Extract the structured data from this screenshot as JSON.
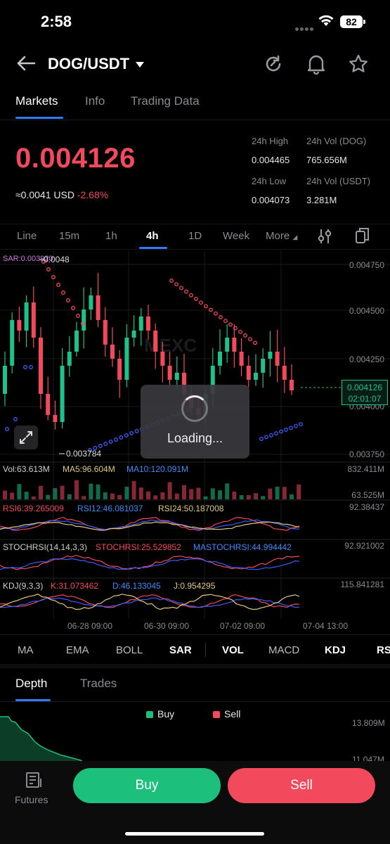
{
  "status": {
    "time": "2:58",
    "battery": "82"
  },
  "header": {
    "pair": "DOG/USDT"
  },
  "tabs": [
    "Markets",
    "Info",
    "Trading Data"
  ],
  "ticker": {
    "price": "0.004126",
    "approx": "≈0.0041 USD",
    "change": "-2.68%",
    "high_label": "24h High",
    "high": "0.004465",
    "vol_dog_label": "24h Vol (DOG)",
    "vol_dog": "765.656M",
    "low_label": "24h Low",
    "low": "0.004073",
    "vol_usdt_label": "24h Vol (USDT)",
    "vol_usdt": "3.281M"
  },
  "timeframes": [
    "Line",
    "15m",
    "1h",
    "4h",
    "1D",
    "Week",
    "More"
  ],
  "chart": {
    "sar_label": "SAR:0.003920",
    "hi_marker": "0.0048",
    "lo_marker": "0.003784",
    "y_ticks": [
      "0.004750",
      "0.004500",
      "0.004250",
      "0.004000",
      "0.003750"
    ],
    "last_price": "0.004126",
    "countdown": "02:01:07",
    "watermark": "MEXC",
    "loading": "Loading...",
    "vol": {
      "label": "Vol:63.613M",
      "ma5": "MA5:96.604M",
      "ma10": "MA10:120.091M",
      "top": "832.411M",
      "bottom": "63.525M"
    },
    "rsi": {
      "r6": "RSI6:39.265009",
      "r12": "RSI12:46.081037",
      "r24": "RSI24:50.187008",
      "top": "92.38437"
    },
    "stochrsi": {
      "label": "STOCHRSI(14,14,3,3)",
      "s": "STOCHRSI:25.529852",
      "ma": "MASTOCHRSI:44.994442",
      "top": "92.921002"
    },
    "kdj": {
      "label": "KDJ(9,3,3)",
      "k": "K:31.073462",
      "d": "D:46.133045",
      "j": "J:0.954295",
      "top": "115.841281"
    },
    "x_ticks": [
      "06-28 09:00",
      "06-30 09:00",
      "07-02 09:00",
      "07-04 13:00"
    ],
    "colors": {
      "up": "#1fc18a",
      "down": "#f2495c",
      "sar_top": "#f2495c",
      "sar_bottom": "#3b5cf6",
      "accent": "#2f7cf6"
    }
  },
  "indicators": [
    "MA",
    "EMA",
    "BOLL",
    "SAR",
    "VOL",
    "MACD",
    "KDJ",
    "RS"
  ],
  "depth": {
    "tab": "Depth",
    "trades": "Trades",
    "buy": "Buy",
    "sell": "Sell",
    "v1": "13.809M",
    "v2": "11.047M"
  },
  "bottom": {
    "futures": "Futures",
    "buy": "Buy",
    "sell": "Sell"
  }
}
